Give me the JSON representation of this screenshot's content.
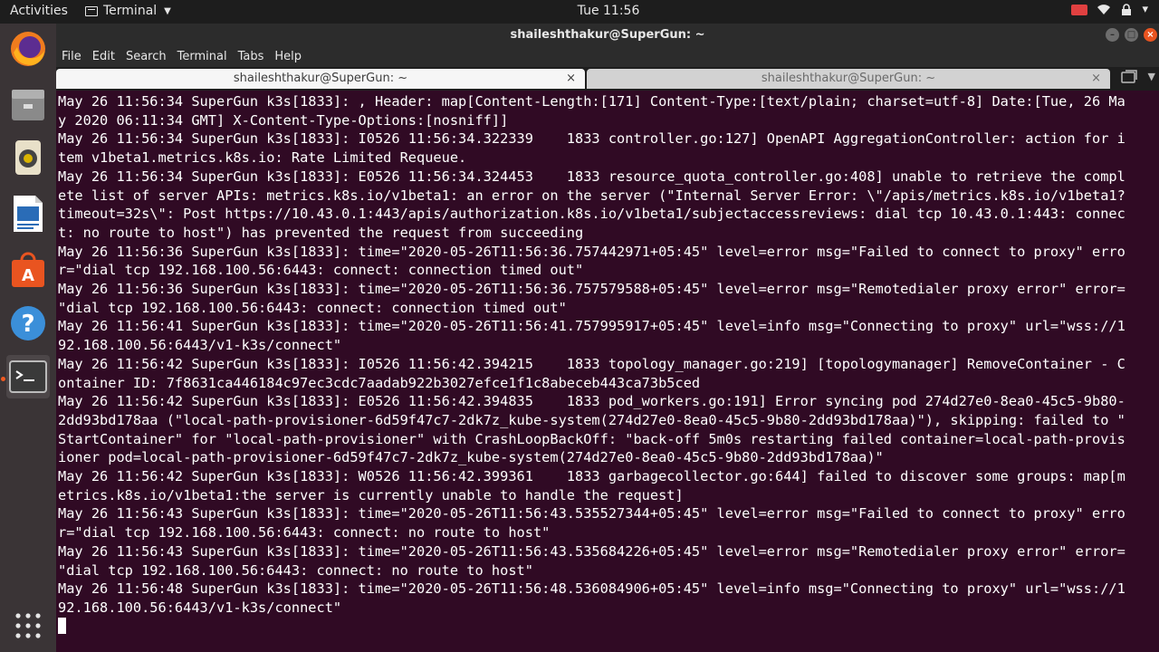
{
  "topbar": {
    "activities": "Activities",
    "app_menu": "Terminal",
    "clock": "Tue 11:56"
  },
  "dock": {
    "items": [
      "Firefox",
      "Files",
      "Rhythmbox",
      "LibreOffice Writer",
      "Ubuntu Software",
      "Help",
      "Terminal"
    ],
    "show_apps": "Show Applications"
  },
  "window": {
    "title": "shaileshthakur@SuperGun: ~",
    "menu": [
      "File",
      "Edit",
      "Search",
      "Terminal",
      "Tabs",
      "Help"
    ],
    "tabs": [
      {
        "label": "shaileshthakur@SuperGun: ~",
        "close": "×",
        "active": true
      },
      {
        "label": "shaileshthakur@SuperGun: ~",
        "close": "×",
        "active": false
      }
    ]
  },
  "terminal": {
    "lines": [
      "May 26 11:56:34 SuperGun k3s[1833]: , Header: map[Content-Length:[171] Content-Type:[text/plain; charset=utf-8] Date:[Tue, 26 Ma",
      "y 2020 06:11:34 GMT] X-Content-Type-Options:[nosniff]]",
      "May 26 11:56:34 SuperGun k3s[1833]: I0526 11:56:34.322339    1833 controller.go:127] OpenAPI AggregationController: action for i",
      "tem v1beta1.metrics.k8s.io: Rate Limited Requeue.",
      "May 26 11:56:34 SuperGun k3s[1833]: E0526 11:56:34.324453    1833 resource_quota_controller.go:408] unable to retrieve the compl",
      "ete list of server APIs: metrics.k8s.io/v1beta1: an error on the server (\"Internal Server Error: \\\"/apis/metrics.k8s.io/v1beta1?",
      "timeout=32s\\\": Post https://10.43.0.1:443/apis/authorization.k8s.io/v1beta1/subjectaccessreviews: dial tcp 10.43.0.1:443: connec",
      "t: no route to host\") has prevented the request from succeeding",
      "May 26 11:56:36 SuperGun k3s[1833]: time=\"2020-05-26T11:56:36.757442971+05:45\" level=error msg=\"Failed to connect to proxy\" erro",
      "r=\"dial tcp 192.168.100.56:6443: connect: connection timed out\"",
      "May 26 11:56:36 SuperGun k3s[1833]: time=\"2020-05-26T11:56:36.757579588+05:45\" level=error msg=\"Remotedialer proxy error\" error=",
      "\"dial tcp 192.168.100.56:6443: connect: connection timed out\"",
      "May 26 11:56:41 SuperGun k3s[1833]: time=\"2020-05-26T11:56:41.757995917+05:45\" level=info msg=\"Connecting to proxy\" url=\"wss://1",
      "92.168.100.56:6443/v1-k3s/connect\"",
      "May 26 11:56:42 SuperGun k3s[1833]: I0526 11:56:42.394215    1833 topology_manager.go:219] [topologymanager] RemoveContainer - C",
      "ontainer ID: 7f8631ca446184c97ec3cdc7aadab922b3027efce1f1c8abeceb443ca73b5ced",
      "May 26 11:56:42 SuperGun k3s[1833]: E0526 11:56:42.394835    1833 pod_workers.go:191] Error syncing pod 274d27e0-8ea0-45c5-9b80-",
      "2dd93bd178aa (\"local-path-provisioner-6d59f47c7-2dk7z_kube-system(274d27e0-8ea0-45c5-9b80-2dd93bd178aa)\"), skipping: failed to \"",
      "StartContainer\" for \"local-path-provisioner\" with CrashLoopBackOff: \"back-off 5m0s restarting failed container=local-path-provis",
      "ioner pod=local-path-provisioner-6d59f47c7-2dk7z_kube-system(274d27e0-8ea0-45c5-9b80-2dd93bd178aa)\"",
      "May 26 11:56:42 SuperGun k3s[1833]: W0526 11:56:42.399361    1833 garbagecollector.go:644] failed to discover some groups: map[m",
      "etrics.k8s.io/v1beta1:the server is currently unable to handle the request]",
      "May 26 11:56:43 SuperGun k3s[1833]: time=\"2020-05-26T11:56:43.535527344+05:45\" level=error msg=\"Failed to connect to proxy\" erro",
      "r=\"dial tcp 192.168.100.56:6443: connect: no route to host\"",
      "May 26 11:56:43 SuperGun k3s[1833]: time=\"2020-05-26T11:56:43.535684226+05:45\" level=error msg=\"Remotedialer proxy error\" error=",
      "\"dial tcp 192.168.100.56:6443: connect: no route to host\"",
      "May 26 11:56:48 SuperGun k3s[1833]: time=\"2020-05-26T11:56:48.536084906+05:45\" level=info msg=\"Connecting to proxy\" url=\"wss://1",
      "92.168.100.56:6443/v1-k3s/connect\""
    ]
  }
}
